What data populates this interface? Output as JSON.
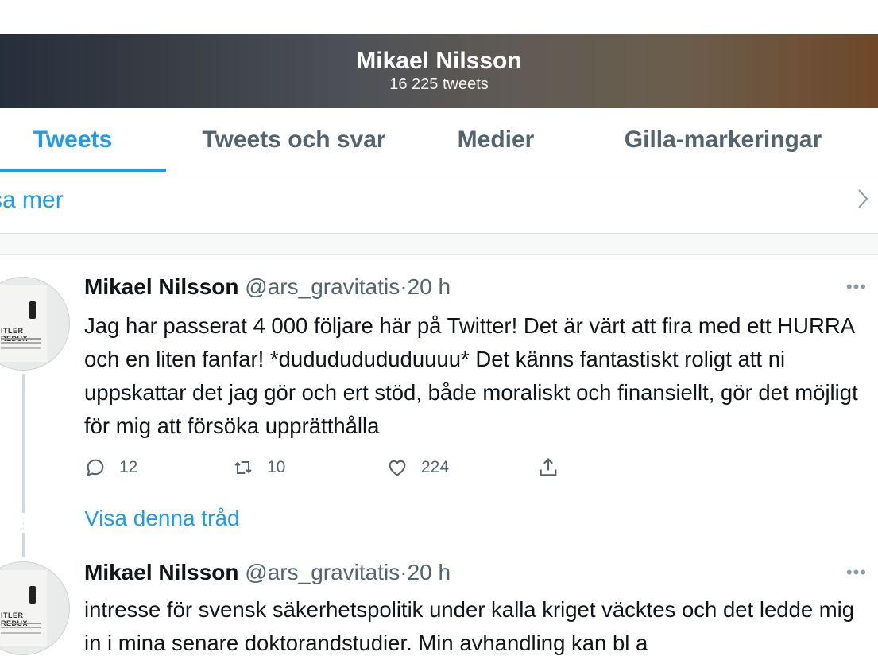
{
  "profile": {
    "name": "Mikael Nilsson",
    "tweet_count": "16 225 tweets"
  },
  "tabs": [
    {
      "label": "Tweets",
      "active": true
    },
    {
      "label": "Tweets och svar"
    },
    {
      "label": "Medier"
    },
    {
      "label": "Gilla-markeringar"
    }
  ],
  "show_more": {
    "label": "sa mer"
  },
  "tweets": [
    {
      "name": "Mikael Nilsson",
      "handle": "@ars_gravitatis",
      "sep": "·",
      "time": "20 h",
      "text": "Jag har passerat 4 000 följare här på Twitter! Det är värt att fira med ett HURRA och en liten fanfar! *dudududududuuuu* Det känns fantastiskt roligt att ni uppskattar det jag gör och ert stöd, både moraliskt och finansiellt, gör det möjligt för mig att försöka upprätthålla",
      "replies": "12",
      "retweets": "10",
      "likes": "224",
      "thread_link": "Visa denna tråd"
    },
    {
      "name": "Mikael Nilsson",
      "handle": "@ars_gravitatis",
      "sep": "·",
      "time": "20 h",
      "text": "intresse för svensk säkerhetspolitik under kalla kriget väcktes och det ledde mig in i mina senare doktorandstudier. Min avhandling kan bl a"
    }
  ],
  "avatar_book_title": "ITLER REDUX",
  "colors": {
    "accent": "#1d9bf0",
    "secondary_text": "#536471",
    "border": "#d9dde0"
  },
  "icons": [
    "reply-icon",
    "retweet-icon",
    "like-icon",
    "share-icon",
    "more-icon",
    "chevron-right-icon"
  ]
}
